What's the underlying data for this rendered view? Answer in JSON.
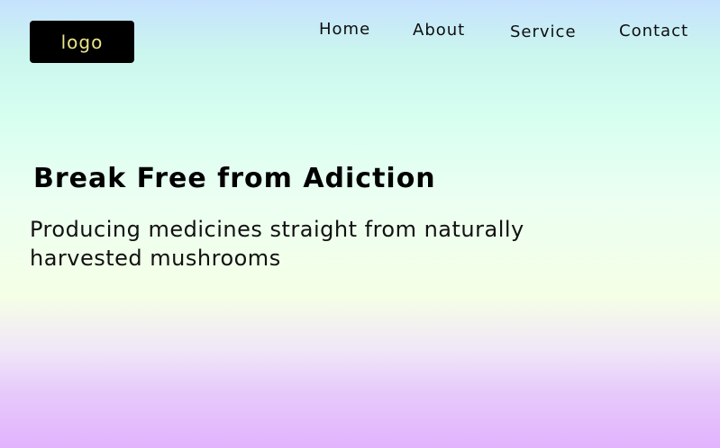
{
  "header": {
    "logo_text": "logo",
    "nav": {
      "home": "Home",
      "about": "About",
      "service": "Service",
      "contact": "Contact"
    }
  },
  "hero": {
    "title": "Break Free from Adiction",
    "subtitle": "Producing medicines straight from naturally harvested mushrooms"
  },
  "colors": {
    "logo_background": "#000000",
    "logo_text": "#ece48a",
    "text": "#000000",
    "background_top": "#c6e2ff",
    "background_middle": "#f5ffe6",
    "background_bottom": "#e2b3fd"
  }
}
